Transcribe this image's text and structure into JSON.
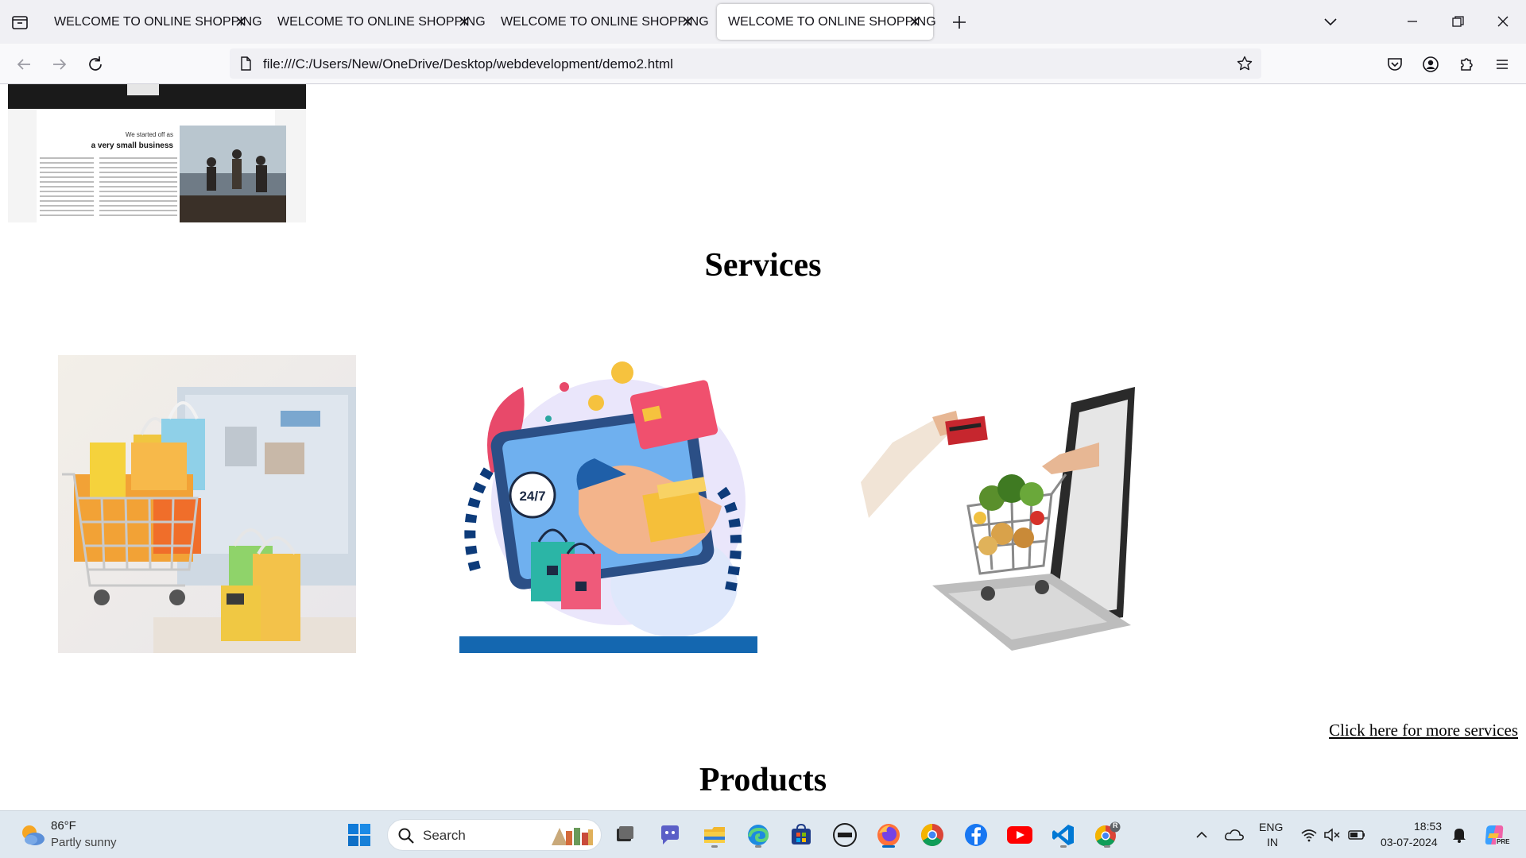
{
  "browser": {
    "tabs": [
      {
        "title": "WELCOME TO ONLINE SHOPPING",
        "active": false
      },
      {
        "title": "WELCOME TO ONLINE SHOPPING",
        "active": false
      },
      {
        "title": "WELCOME TO ONLINE SHOPPING",
        "active": false
      },
      {
        "title": "WELCOME TO ONLINE SHOPPING",
        "active": true
      }
    ],
    "url": "file:///C:/Users/New/OneDrive/Desktop/webdevelopment/demo2.html"
  },
  "page": {
    "services_heading": "Services",
    "more_services_link": "Click here for more services",
    "products_heading": "Products",
    "clipping_text": {
      "line1": "We started off as",
      "line2": "a very small business"
    },
    "service_images": [
      {
        "name": "shopping-cart-bags-laptop"
      },
      {
        "name": "24-7-delivery-illustration",
        "badge": "24/7"
      },
      {
        "name": "laptop-grocery-cart"
      }
    ]
  },
  "taskbar": {
    "weather_temp": "86°F",
    "weather_desc": "Partly sunny",
    "search_placeholder": "Search",
    "lang_line1": "ENG",
    "lang_line2": "IN",
    "time": "18:53",
    "date": "03-07-2024",
    "profile_badge": "R",
    "preview_badge": "PRE"
  },
  "colors": {
    "tabstrip": "#f0f0f4",
    "toolbar": "#f9f9fb",
    "taskbar": "#dfe8f0",
    "accent": "#0067c0"
  }
}
